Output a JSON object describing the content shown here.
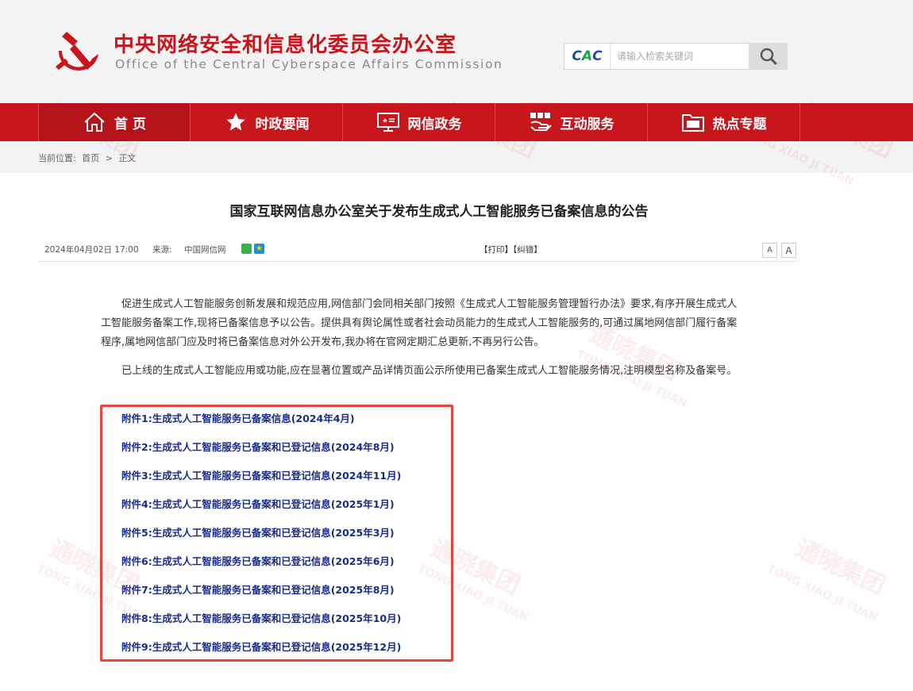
{
  "site": {
    "title": "中央网络安全和信息化委员会办公室",
    "subtitle": "Office of the Central Cyberspace Affairs Commission"
  },
  "search": {
    "logo_text": "CAC",
    "placeholder": "请输入检索关键词"
  },
  "nav": [
    {
      "label": "首 页",
      "icon": "home-icon"
    },
    {
      "label": "时政要闻",
      "icon": "star-icon"
    },
    {
      "label": "网信政务",
      "icon": "monitor-icon"
    },
    {
      "label": "互动服务",
      "icon": "people-icon"
    },
    {
      "label": "热点专题",
      "icon": "folder-icon"
    }
  ],
  "breadcrumb": {
    "label": "当前位置:",
    "home": "首页",
    "separator": ">",
    "current": "正文"
  },
  "article": {
    "title": "国家互联网信息办公室关于发布生成式人工智能服务已备案信息的公告",
    "date": "2024年04月02日  17:00",
    "source_label": "来源:",
    "source": "中国网信网",
    "actions": "【打印】【纠错】",
    "font_small": "A",
    "font_large": "A",
    "paragraphs": [
      "促进生成式人工智能服务创新发展和规范应用,网信部门会同相关部门按照《生成式人工智能服务管理暂行办法》要求,有序开展生成式人工智能服务备案工作,现将已备案信息予以公告。提供具有舆论属性或者社会动员能力的生成式人工智能服务的,可通过属地网信部门履行备案程序,属地网信部门应及时将已备案信息对外公开发布,我办将在官网定期汇总更新,不再另行公告。",
      "已上线的生成式人工智能应用或功能,应在显著位置或产品详情页面公示所使用已备案生成式人工智能服务情况,注明模型名称及备案号。"
    ],
    "attachments": [
      "附件1:生成式人工智能服务已备案信息(2024年4月)",
      "附件2:生成式人工智能服务已备案和已登记信息(2024年8月)",
      "附件3:生成式人工智能服务已备案和已登记信息(2024年11月)",
      "附件4:生成式人工智能服务已备案和已登记信息(2025年1月)",
      "附件5:生成式人工智能服务已备案和已登记信息(2025年3月)",
      "附件6:生成式人工智能服务已备案和已登记信息(2025年6月)",
      "附件7:生成式人工智能服务已备案和已登记信息(2025年8月)",
      "附件8:生成式人工智能服务已备案和已登记信息(2025年10月)",
      "附件9:生成式人工智能服务已备案和已登记信息(2025年12月)"
    ]
  },
  "watermark": {
    "cn": "通晓集团",
    "en": "TONG XIAO JI TUAN"
  },
  "colors": {
    "brand_red": "#c8161d",
    "link_navy": "#1a2a8a",
    "highlight_box": "#e8463a"
  }
}
